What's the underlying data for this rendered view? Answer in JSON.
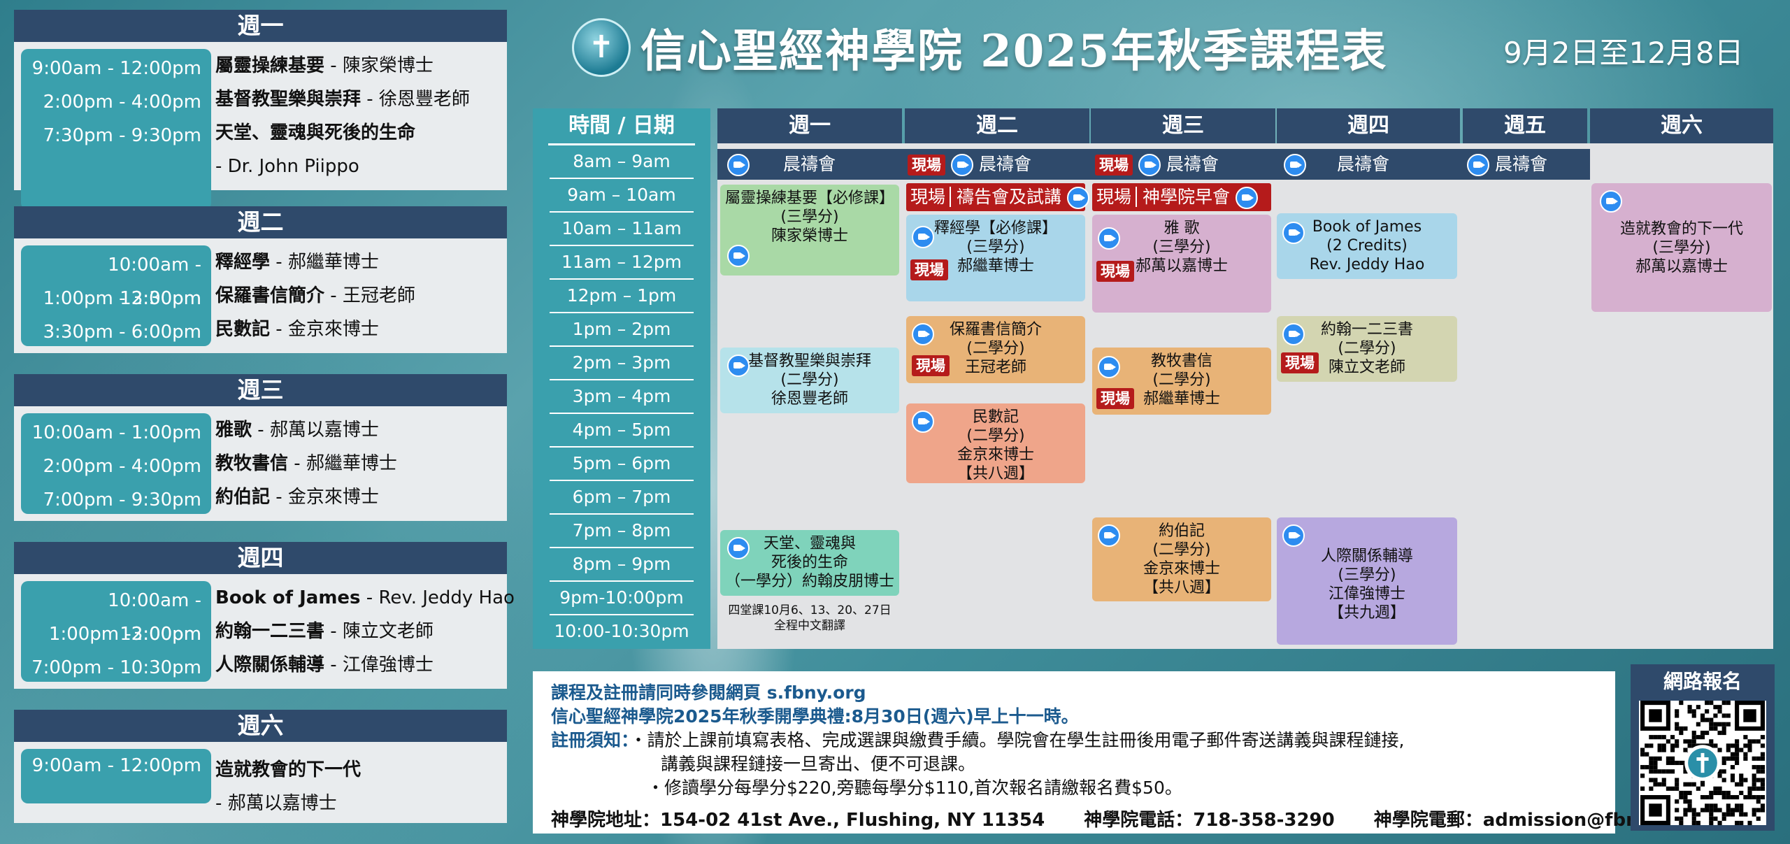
{
  "title": "信心聖經神學院 2025年秋季課程表",
  "dates": "9月2日至12月8日",
  "logo_glyph": "✝",
  "summary": [
    {
      "day": "週一",
      "rows": [
        {
          "time": "9:00am - 12:00pm",
          "course": "屬靈操練基要",
          "teacher": " - 陳家榮博士"
        },
        {
          "time": "2:00pm - 4:00pm",
          "course": "基督教聖樂與崇拜",
          "teacher": " - 徐恩豐老師"
        },
        {
          "time": "7:30pm - 9:30pm",
          "course": "天堂、靈魂與死後的生命",
          "teacher": ""
        },
        {
          "time": "",
          "course": "",
          "teacher": " - Dr. John Piippo"
        }
      ]
    },
    {
      "day": "週二",
      "rows": [
        {
          "time": "10:00am - 12:30pm",
          "course": "釋經學",
          "teacher": " - 郝繼華博士"
        },
        {
          "time": "1:00pm - 3:00pm",
          "course": "保羅書信簡介",
          "teacher": " - 王冠老師"
        },
        {
          "time": "3:30pm - 6:00pm",
          "course": "民數記",
          "teacher": " - 金京來博士"
        }
      ]
    },
    {
      "day": "週三",
      "rows": [
        {
          "time": "10:00am - 1:00pm",
          "course": "雅歌",
          "teacher": " - 郝萬以嘉博士"
        },
        {
          "time": "2:00pm - 4:00pm",
          "course": "教牧書信",
          "teacher": " - 郝繼華博士"
        },
        {
          "time": "7:00pm - 9:30pm",
          "course": "約伯記",
          "teacher": " - 金京來博士"
        }
      ]
    },
    {
      "day": "週四",
      "rows": [
        {
          "time": "10:00am - 12:00pm",
          "course": "Book of James",
          "teacher": " - Rev. Jeddy Hao"
        },
        {
          "time": "1:00pm -3:00pm",
          "course": "約翰一二三書",
          "teacher": " - 陳立文老師"
        },
        {
          "time": "7:00pm - 10:30pm",
          "course": "人際關係輔導",
          "teacher": " - 江偉強博士"
        }
      ]
    },
    {
      "day": "週六",
      "rows": [
        {
          "time": "9:00am - 12:00pm",
          "course": "造就教會的下一代",
          "teacher": ""
        },
        {
          "time": "",
          "course": "",
          "teacher": " - 郝萬以嘉博士"
        }
      ]
    }
  ],
  "grid": {
    "time_header": "時間 / 日期",
    "slots": [
      "8am – 9am",
      "9am – 10am",
      "10am – 11am",
      "11am – 12pm",
      "12pm – 1pm",
      "1pm – 2pm",
      "2pm – 3pm",
      "3pm – 4pm",
      "4pm – 5pm",
      "5pm – 6pm",
      "6pm – 7pm",
      "7pm – 8pm",
      "8pm – 9pm",
      "9pm-10:00pm",
      "10:00-10:30pm"
    ],
    "days": [
      "週一",
      "週二",
      "週三",
      "週四",
      "週五",
      "週六"
    ],
    "onsite_label": "現場",
    "prayer_label": "晨禱會",
    "tue_bar": "禱告會及試講",
    "wed_bar": "神學院早會",
    "courses": {
      "mon1": [
        "屬靈操練基要【必修課】",
        "(三學分)",
        "陳家榮博士"
      ],
      "mon2": [
        "基督教聖樂與崇拜",
        "(二學分)",
        "徐恩豐老師"
      ],
      "mon3": [
        "天堂、靈魂與",
        "死後的生命",
        "（一學分）約翰皮朋博士"
      ],
      "mon3_note": [
        "四堂課10月6、13、20、27日",
        "全程中文翻譯"
      ],
      "tue1": [
        "釋經學【必修課】",
        "(三學分)",
        "郝繼華博士"
      ],
      "tue2": [
        "保羅書信簡介",
        "(二學分)",
        "王冠老師"
      ],
      "tue3": [
        "民數記",
        "(二學分)",
        "金京來博士",
        "【共八週】"
      ],
      "wed1": [
        "雅 歌",
        "(三學分)",
        "郝萬以嘉博士"
      ],
      "wed2": [
        "教牧書信",
        "(二學分)",
        "郝繼華博士"
      ],
      "wed3": [
        "約伯記",
        "(二學分)",
        "金京來博士",
        "【共八週】"
      ],
      "thu1": [
        "Book of James",
        "(2 Credits)",
        "Rev. Jeddy Hao"
      ],
      "thu2": [
        "約翰一二三書",
        "(二學分)",
        "陳立文老師"
      ],
      "thu3": [
        "人際關係輔導",
        "(三學分)",
        "江偉強博士",
        "【共九週】"
      ],
      "sat1": [
        "造就教會的下一代",
        "(三學分)",
        "郝萬以嘉博士"
      ]
    }
  },
  "info": {
    "line1": "課程及註冊請同時參閱網頁 s.fbny.org",
    "line2": "信心聖經神學院2025年秋季開學典禮:8月30日(週六)早上十一時。",
    "notice_label": "註冊須知：",
    "bullet1a": "・請於上課前填寫表格、完成選課與繳費手續。學院會在學生註冊後用電子郵件寄送講義與課程鏈接,",
    "bullet1b": "講義與課程鏈接一旦寄出、便不可退課。",
    "bullet2": "・修讀學分每學分$220,旁聽每學分$110,首次報名請繳報名費$50。",
    "address": "神學院地址：154-02 41st Ave., Flushing, NY 11354",
    "phone": "神學院電話：718-358-3290",
    "email": "神學院電郵：admission@fbny.org"
  },
  "register_label": "網路報名",
  "colors": {
    "navy": "#2f4a6b",
    "teal": "#3aa0ad",
    "onsite_red": "#b51b1b",
    "green": "#a9d9a6",
    "light_blue": "#a9d6ea",
    "aqua": "#b6e2ea",
    "mint": "#7fd3bb",
    "pink": "#d6b0cf",
    "orange": "#e8b377",
    "salmon": "#efa58a",
    "khaki": "#d3d5b1",
    "lavender": "#b7a8df"
  }
}
